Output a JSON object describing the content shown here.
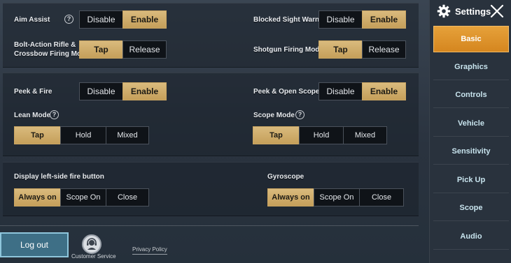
{
  "settings": {
    "aim_assist": {
      "label": "Aim Assist",
      "options": [
        "Disable",
        "Enable"
      ]
    },
    "blocked_sight": {
      "label": "Blocked Sight Warning",
      "options": [
        "Disable",
        "Enable"
      ]
    },
    "bolt_action": {
      "label_line1": "Bolt-Action Rifle &",
      "label_line2": "Crossbow Firing Mode",
      "options": [
        "Tap",
        "Release"
      ]
    },
    "shotgun": {
      "label": "Shotgun Firing Mode",
      "options": [
        "Tap",
        "Release"
      ]
    },
    "peek_fire": {
      "label": "Peek & Fire",
      "options": [
        "Disable",
        "Enable"
      ]
    },
    "peek_scope": {
      "label": "Peek & Open Scope",
      "options": [
        "Disable",
        "Enable"
      ]
    },
    "lean_mode": {
      "label": "Lean Mode",
      "options": [
        "Tap",
        "Hold",
        "Mixed"
      ]
    },
    "scope_mode": {
      "label": "Scope Mode",
      "options": [
        "Tap",
        "Hold",
        "Mixed"
      ]
    },
    "left_fire": {
      "label": "Display left-side fire button",
      "options": [
        "Always on",
        "Scope On",
        "Close"
      ]
    },
    "gyroscope": {
      "label": "Gyroscope",
      "options": [
        "Always on",
        "Scope On",
        "Close"
      ]
    },
    "help_glyph": "?"
  },
  "footer": {
    "logout": "Log out",
    "customer_service": "Customer Service",
    "privacy_policy": "Privacy Policy"
  },
  "sidebar": {
    "title": "Settings",
    "items": [
      "Basic",
      "Graphics",
      "Controls",
      "Vehicle",
      "Sensitivity",
      "Pick Up",
      "Scope",
      "Audio"
    ],
    "active": "Basic"
  },
  "colors": {
    "selected_option": "#d1af6c",
    "active_tab": "#e0982f",
    "logout_button": "#3e6f86"
  }
}
